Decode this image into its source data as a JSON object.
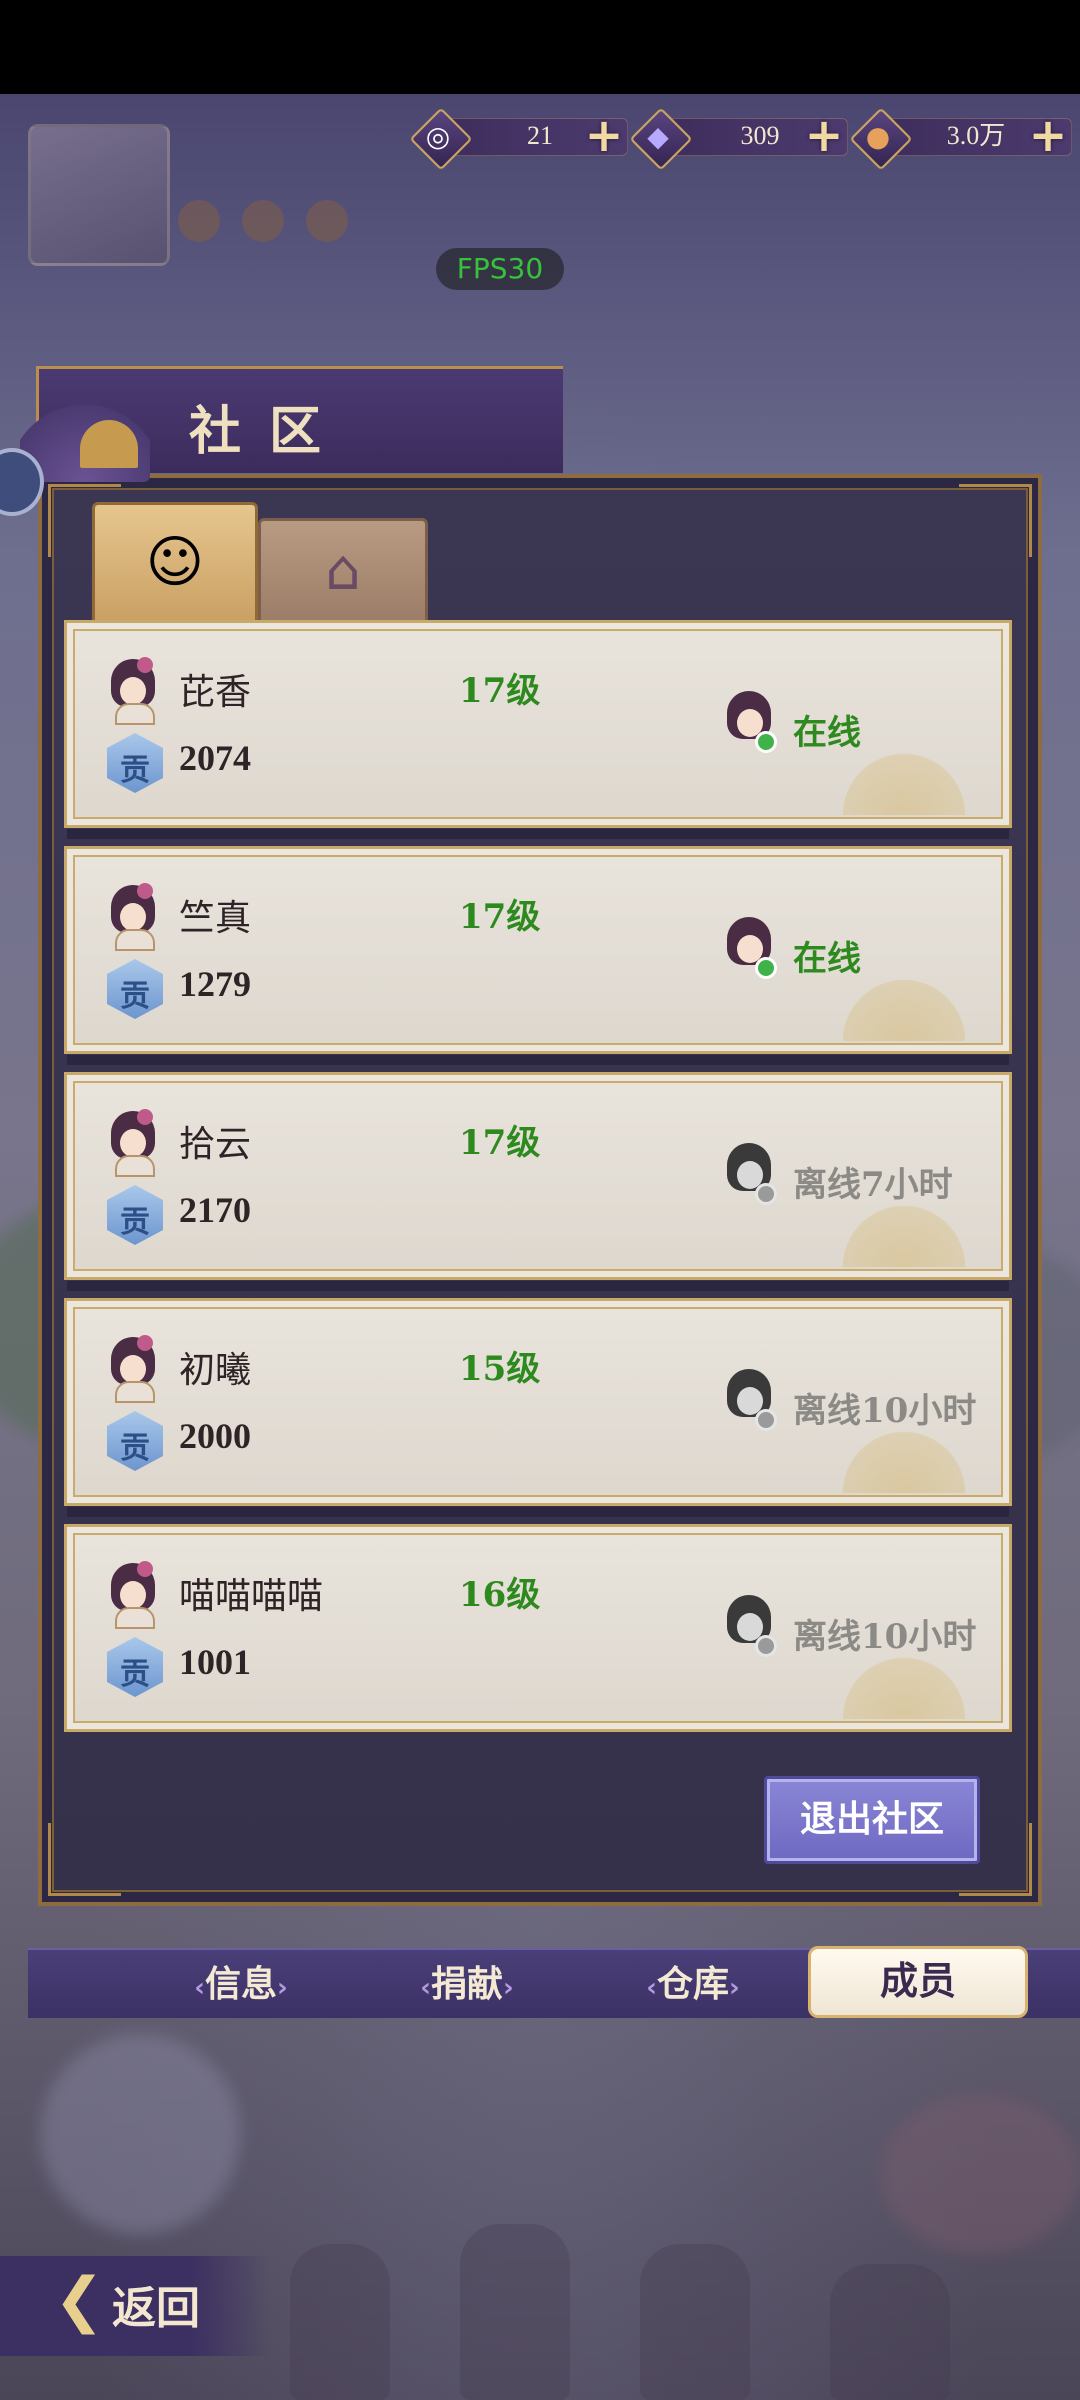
{
  "currencies": [
    {
      "icon": "bun-icon",
      "value": "21"
    },
    {
      "icon": "crystal-icon",
      "value": "309"
    },
    {
      "icon": "coin-icon",
      "value": "3.0万"
    }
  ],
  "fps": "FPS30",
  "panel_title": "社区",
  "tabs": [
    {
      "icon": "member-tab-icon",
      "selected": true
    },
    {
      "icon": "building-tab-icon",
      "selected": false
    }
  ],
  "members": [
    {
      "name": "芘香",
      "level": "17级",
      "contribution": "2074",
      "status": "在线",
      "online": true
    },
    {
      "name": "竺真",
      "level": "17级",
      "contribution": "1279",
      "status": "在线",
      "online": true
    },
    {
      "name": "拾云",
      "level": "17级",
      "contribution": "2170",
      "status": "离线7小时",
      "online": false
    },
    {
      "name": "初曦",
      "level": "15级",
      "contribution": "2000",
      "status": "离线10小时",
      "online": false
    },
    {
      "name": "喵喵喵喵",
      "level": "16级",
      "contribution": "1001",
      "status": "离线10小时",
      "online": false
    }
  ],
  "contribution_badge": "贡",
  "quit_button": "退出社区",
  "bottom_tabs": [
    "信息",
    "捐献",
    "仓库",
    "成员"
  ],
  "active_bottom_tab": "成员",
  "back_button": "返回",
  "colors": {
    "online": "#2e8a1f",
    "offline": "#8c8a86",
    "accent_gold": "#c8a967",
    "panel_purple": "#3b3652"
  }
}
